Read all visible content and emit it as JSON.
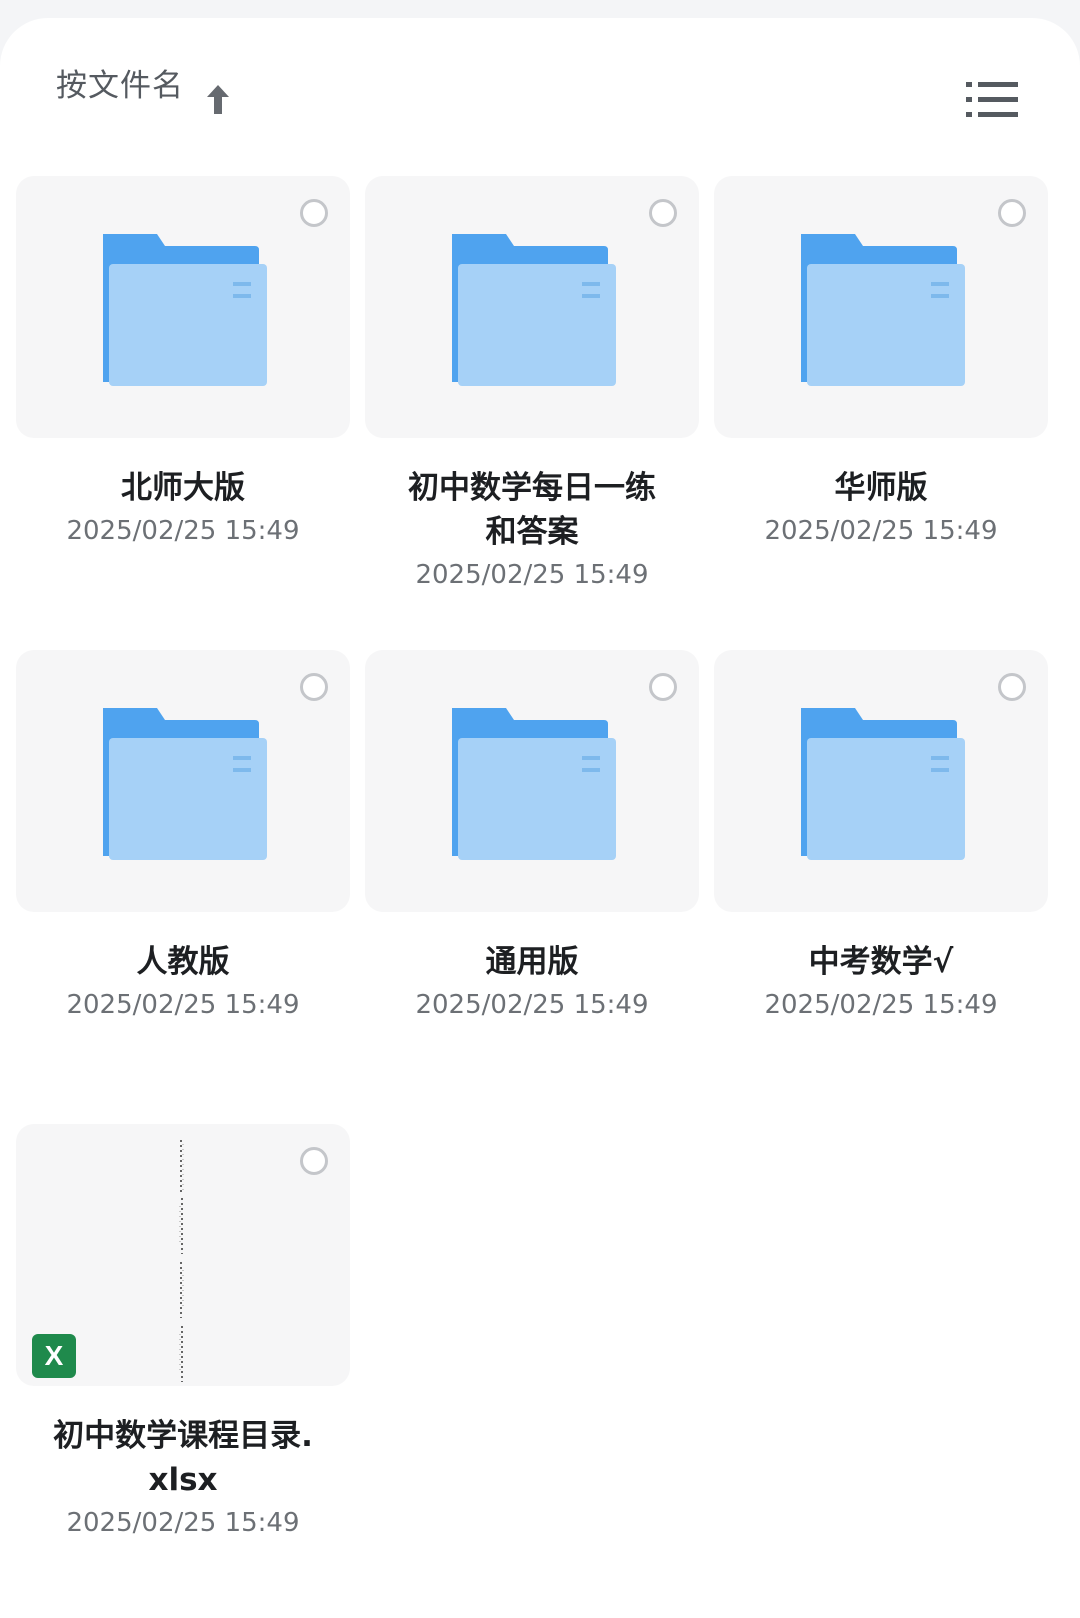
{
  "toolbar": {
    "sort_label": "按文件名",
    "sort_direction_icon": "arrow-up-icon",
    "view_toggle_icon": "list-view-icon"
  },
  "colors": {
    "folder_back": "#4fa3ef",
    "folder_front": "#a6d1f7",
    "excel_green": "#1f8a4c"
  },
  "items": [
    {
      "name": "北师大版",
      "date": "2025/02/25 15:49",
      "type": "folder"
    },
    {
      "name_line1": "初中数学每日一练",
      "name_line2": "和答案",
      "date": "2025/02/25 15:49",
      "type": "folder"
    },
    {
      "name": "华师版",
      "date": "2025/02/25 15:49",
      "type": "folder"
    },
    {
      "name": "人教版",
      "date": "2025/02/25 15:49",
      "type": "folder"
    },
    {
      "name": "通用版",
      "date": "2025/02/25 15:49",
      "type": "folder"
    },
    {
      "name": "中考数学√",
      "date": "2025/02/25 15:49",
      "type": "folder"
    },
    {
      "name_line1": "初中数学课程目录.",
      "name_line2": "xlsx",
      "date": "2025/02/25 15:49",
      "type": "xlsx",
      "badge": "X"
    }
  ]
}
